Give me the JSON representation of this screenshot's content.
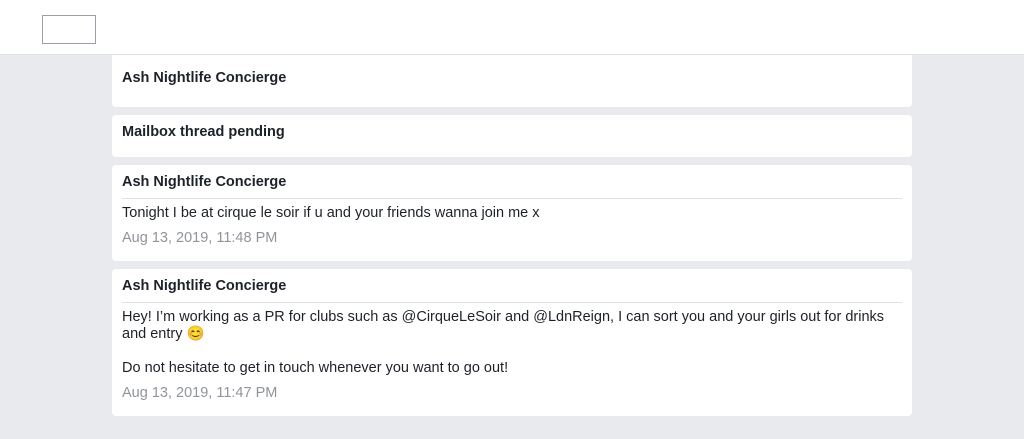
{
  "header": {
    "logo_label": ""
  },
  "cards": {
    "sender_card": {
      "title": "Ash Nightlife Concierge"
    },
    "status_card": {
      "title": "Mailbox thread pending"
    },
    "messages": [
      {
        "sender": "Ash Nightlife Concierge",
        "paragraphs": [
          "Tonight I be at cirque le soir if u and your friends wanna join me x"
        ],
        "timestamp": "Aug 13, 2019, 11:48 PM"
      },
      {
        "sender": "Ash Nightlife Concierge",
        "paragraphs": [
          "Hey! I’m working as a PR for clubs such as @CirqueLeSoir and @LdnReign, I can sort you and your girls out for drinks and entry 😊",
          "Do not hesitate to get in touch whenever you want to go out!"
        ],
        "timestamp": "Aug 13, 2019, 11:47 PM"
      }
    ]
  },
  "colors": {
    "page_background": "#e9eaed",
    "card_background": "#ffffff",
    "timestamp_color": "#90949c",
    "divider_color": "#dddfe2"
  }
}
